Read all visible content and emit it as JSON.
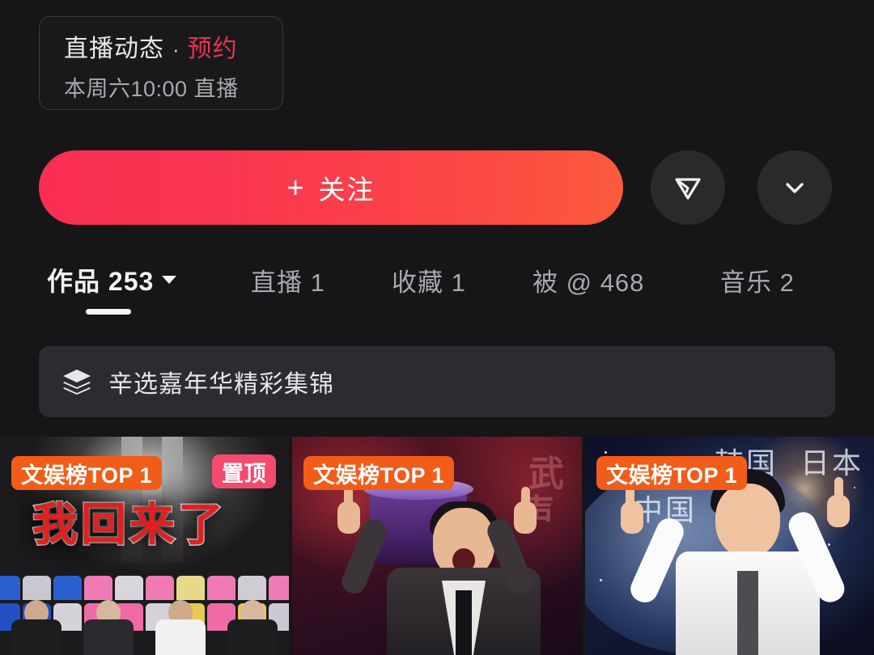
{
  "live_card": {
    "title": "直播动态",
    "separator": "·",
    "status": "预约",
    "schedule": "本周六10:00 直播",
    "status_color": "#e8334f"
  },
  "actions": {
    "follow_label": "关注",
    "follow_plus": "+",
    "follow_gradient_from": "#fa2e52",
    "follow_gradient_to": "#fb5a3c",
    "share_icon": "share-plane-icon",
    "more_icon": "chevron-down-icon"
  },
  "tabs": [
    {
      "label": "作品 253",
      "active": true,
      "has_caret": true
    },
    {
      "label": "直播 1",
      "active": false,
      "has_caret": false
    },
    {
      "label": "收藏 1",
      "active": false,
      "has_caret": false
    },
    {
      "label": "被 @ 468",
      "active": false,
      "has_caret": false
    },
    {
      "label": "音乐 2",
      "active": false,
      "has_caret": false
    }
  ],
  "collection": {
    "icon": "layers-icon",
    "label": "辛选嘉年华精彩集锦"
  },
  "thumbnails": [
    {
      "rank_badge": "文娱榜TOP 1",
      "pin_badge": "置顶",
      "overlay_title": "我回来了",
      "rank_badge_color": "#f25c19",
      "pin_badge_color": "#f44a6e"
    },
    {
      "rank_badge": "文娱榜TOP 1",
      "pin_badge": "",
      "overlay_title": "",
      "bg_char_1": "武",
      "bg_char_2": "声",
      "rank_badge_color": "#f25c19"
    },
    {
      "rank_badge": "文娱榜TOP 1",
      "pin_badge": "",
      "overlay_title": "",
      "geo_1": "韩国",
      "geo_2": "日本",
      "geo_3": "中国",
      "rank_badge_color": "#f25c19"
    }
  ]
}
